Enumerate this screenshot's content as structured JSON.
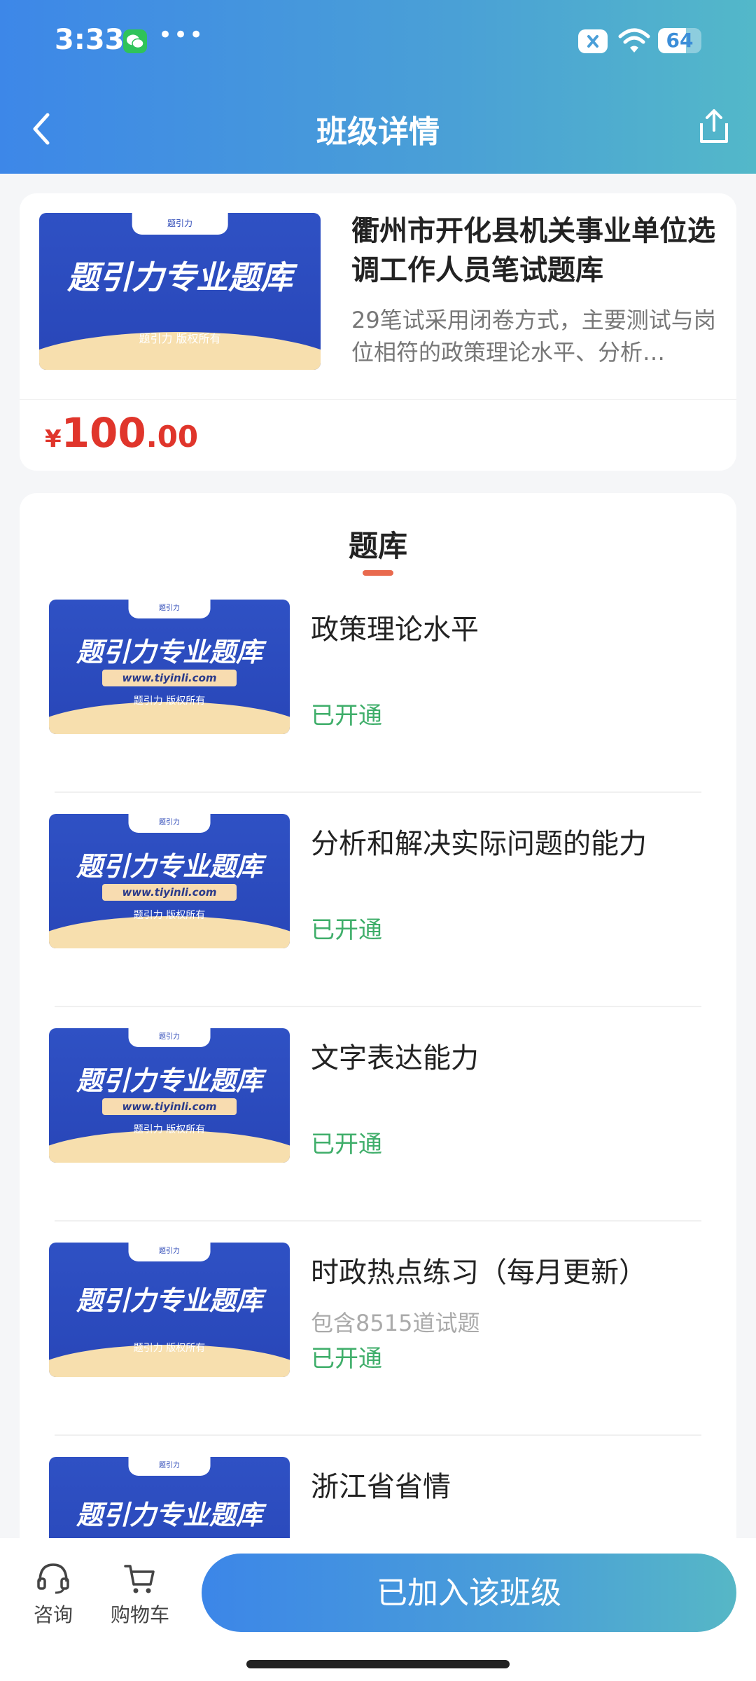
{
  "status_bar": {
    "time": "3:33",
    "dots": "•••",
    "battery": "64"
  },
  "nav": {
    "title": "班级详情"
  },
  "course": {
    "thumb_title": "题引力专业题库",
    "thumb_tab": "题引力",
    "thumb_copyright": "题引力 版权所有",
    "title": "衢州市开化县机关事业单位选调工作人员笔试题库",
    "description": "29笔试采用闭卷方式，主要测试与岗位相符的政策理论水平、分析…",
    "price": {
      "currency": "¥",
      "integer": "100",
      "decimal": ".00"
    }
  },
  "bank": {
    "title": "题库",
    "thumb_url": "www.tiyinli.com",
    "items": [
      {
        "name": "政策理论水平",
        "count": "",
        "status": "已开通"
      },
      {
        "name": "分析和解决实际问题的能力",
        "count": "",
        "status": "已开通"
      },
      {
        "name": "文字表达能力",
        "count": "",
        "status": "已开通"
      },
      {
        "name": "时政热点练习（每月更新）",
        "count": "包含8515道试题",
        "status": "已开通"
      },
      {
        "name": "浙江省省情",
        "count": "",
        "status": ""
      }
    ]
  },
  "bottom": {
    "consult_label": "咨询",
    "cart_label": "购物车",
    "join_label": "已加入该班级"
  },
  "colors": {
    "accent": "#3d87e8",
    "price": "#e0352b",
    "opened": "#3fae6a",
    "underline": "#e96a4e"
  }
}
